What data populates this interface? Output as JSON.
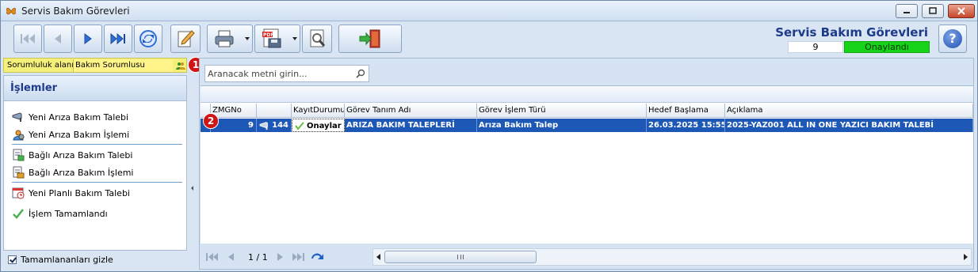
{
  "window": {
    "title": "Servis Bakım Görevleri"
  },
  "header": {
    "title": "Servis Bakım Görevleri",
    "count": "9",
    "status": "Onaylandı",
    "status_color": "#17d317"
  },
  "responsibility": {
    "label": "Sorumluluk alanı",
    "value": "Bakım Sorumlusu",
    "highlight_color": "#f5f07a",
    "marker": "1"
  },
  "toolbar": {
    "buttons": [
      "first-record-icon",
      "previous-record-icon",
      "next-record-icon",
      "last-record-icon",
      "refresh-icon",
      "edit-icon",
      "print-icon",
      "pdf-export-icon",
      "tools-icon",
      "exit-icon"
    ]
  },
  "sidebar": {
    "title": "İşlemler",
    "items": [
      {
        "label": "Yeni Arıza Bakım Talebi",
        "icon": "fault-request-icon"
      },
      {
        "label": "Yeni Arıza Bakım İşlemi",
        "icon": "fault-process-icon"
      },
      {
        "label": "Bağlı Arıza Bakım Talebi",
        "icon": "linked-request-icon"
      },
      {
        "label": "Bağlı Arıza Bakım İşlemi",
        "icon": "linked-process-icon"
      },
      {
        "label": "Yeni Planlı Bakım Talebi",
        "icon": "planned-request-icon"
      },
      {
        "label": "İşlem Tamamlandı",
        "icon": "check-icon"
      }
    ],
    "hide_completed_label": "Tamamlananları gizle",
    "hide_completed_checked": true
  },
  "search": {
    "placeholder": "Aranacak metni girin..."
  },
  "grid": {
    "columns": [
      "ZMGNo",
      "",
      "KayıtDurumu",
      "Görev Tanım Adı",
      "Görev İşlem Türü",
      "Hedef Başlama",
      "Açıklama"
    ],
    "rows": [
      {
        "marker": "2",
        "zmgno": "9",
        "number": "144",
        "status": "Onaylar",
        "task_name": "ARIZA BAKIM TALEPLERİ",
        "process_type": "Arıza Bakım Talep",
        "target_start": "26.03.2025 15:55",
        "description": "2025-YAZ001 ALL IN ONE YAZICI BAKIM TALEBİ"
      }
    ],
    "selected_row_color": "#1d58b6"
  },
  "pager": {
    "text": "1 / 1"
  }
}
